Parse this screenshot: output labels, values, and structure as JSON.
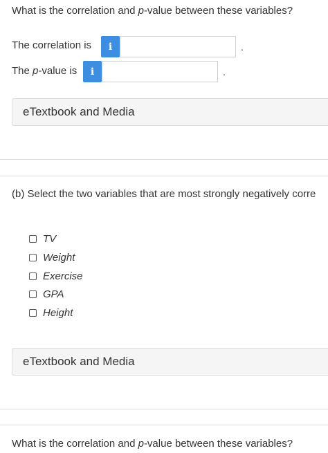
{
  "question_top": {
    "text_before": "What is the correlation and ",
    "text_italic": "p",
    "text_after": "-value between these variables?"
  },
  "correlation_row": {
    "label": "The correlation is",
    "info_icon": "info-icon",
    "input_value": "",
    "period": "."
  },
  "pvalue_row": {
    "label_before": "The ",
    "label_italic": "p",
    "label_after": "-value is",
    "info_icon": "info-icon",
    "input_value": "",
    "period": "."
  },
  "etextbook_1": {
    "label": "eTextbook and Media"
  },
  "part_b": {
    "question": "(b) Select the two variables that are most strongly negatively corre"
  },
  "options": [
    {
      "label": "TV",
      "checked": false
    },
    {
      "label": "Weight",
      "checked": false
    },
    {
      "label": "Exercise",
      "checked": false
    },
    {
      "label": "GPA",
      "checked": false
    },
    {
      "label": "Height",
      "checked": false
    }
  ],
  "etextbook_2": {
    "label": "eTextbook and Media"
  },
  "question_bottom": {
    "text_before": "What is the correlation and ",
    "text_italic": "p",
    "text_after": "-value between these variables?"
  },
  "colors": {
    "info_button": "#3d8ee0",
    "text": "#333333",
    "etext_bg": "#f5f5f5",
    "divider": "#d9d9d9"
  }
}
